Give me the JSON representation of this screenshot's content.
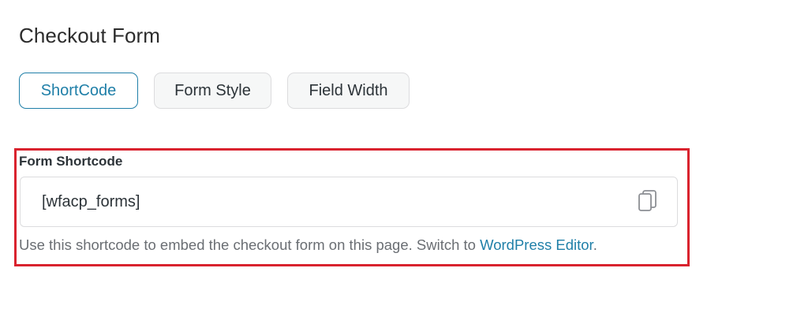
{
  "page": {
    "title": "Checkout Form"
  },
  "tabs": [
    {
      "label": "ShortCode",
      "active": true
    },
    {
      "label": "Form Style",
      "active": false
    },
    {
      "label": "Field Width",
      "active": false
    }
  ],
  "shortcode_section": {
    "label": "Form Shortcode",
    "value": "[wfacp_forms]",
    "copy_icon": "copy-icon",
    "help_text": "Use this shortcode to embed the checkout form on this page. Switch to ",
    "help_link": "WordPress Editor",
    "help_suffix": "."
  },
  "colors": {
    "accent": "#1f7fa8",
    "highlight_border": "#d9232e",
    "muted_text": "#6a6e73"
  }
}
